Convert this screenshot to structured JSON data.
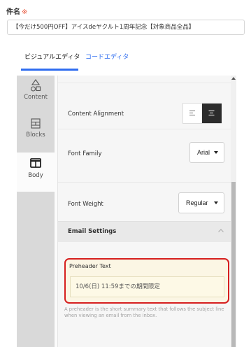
{
  "subject": {
    "label": "件名",
    "required_mark": "※",
    "value": "【今だけ500円OFF】アイスdeヤクルト1周年記念【対象商品全品】"
  },
  "tabs": {
    "visual_editor": "ビジュアルエディタ",
    "code_editor": "コードエディタ",
    "active": "visual_editor"
  },
  "rail": {
    "content": "Content",
    "blocks": "Blocks",
    "body": "Body",
    "active": "body"
  },
  "settings": {
    "content_alignment_label": "Content Alignment",
    "alignment_selected": "center",
    "font_family_label": "Font Family",
    "font_family_value": "Arial",
    "font_weight_label": "Font Weight",
    "font_weight_value": "Regular"
  },
  "email_settings": {
    "section_title": "Email Settings",
    "expanded": true,
    "preheader_label": "Preheader Text",
    "preheader_value": "10/6(日) 11:59までの期間限定",
    "help_text": "A preheader is the short summary text that follows the subject line when viewing an email from the inbox."
  },
  "colors": {
    "accent": "#2f6df0",
    "highlight_border": "#d61f1f",
    "preheader_bg": "#fbf6e4",
    "required": "#e8573c"
  }
}
